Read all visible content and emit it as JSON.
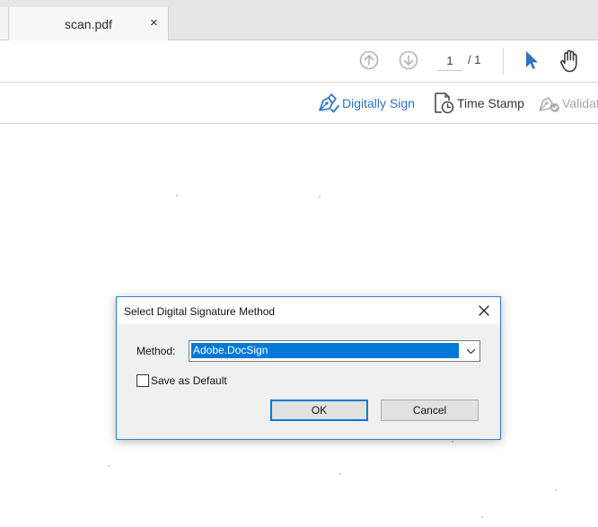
{
  "tab": {
    "title": "scan.pdf",
    "close": "×"
  },
  "toolbar": {
    "page_current": "1",
    "page_total": "/ 1",
    "icons": [
      "prev-page-icon",
      "next-page-icon",
      "select-cursor-icon",
      "hand-tool-icon"
    ]
  },
  "sign_toolbar": {
    "digitally_sign": "Digitally Sign",
    "time_stamp": "Time Stamp",
    "validate": "Validat"
  },
  "dialog": {
    "title": "Select Digital Signature Method",
    "method_label": "Method:",
    "method_value": "Adobe.DocSign",
    "save_default_label": "Save as Default",
    "save_default_checked": false,
    "ok_label": "OK",
    "cancel_label": "Cancel"
  },
  "colors": {
    "accent_blue": "#2a72c4",
    "selection_blue": "#0078d7",
    "disabled_gray": "#a8a8a8"
  }
}
